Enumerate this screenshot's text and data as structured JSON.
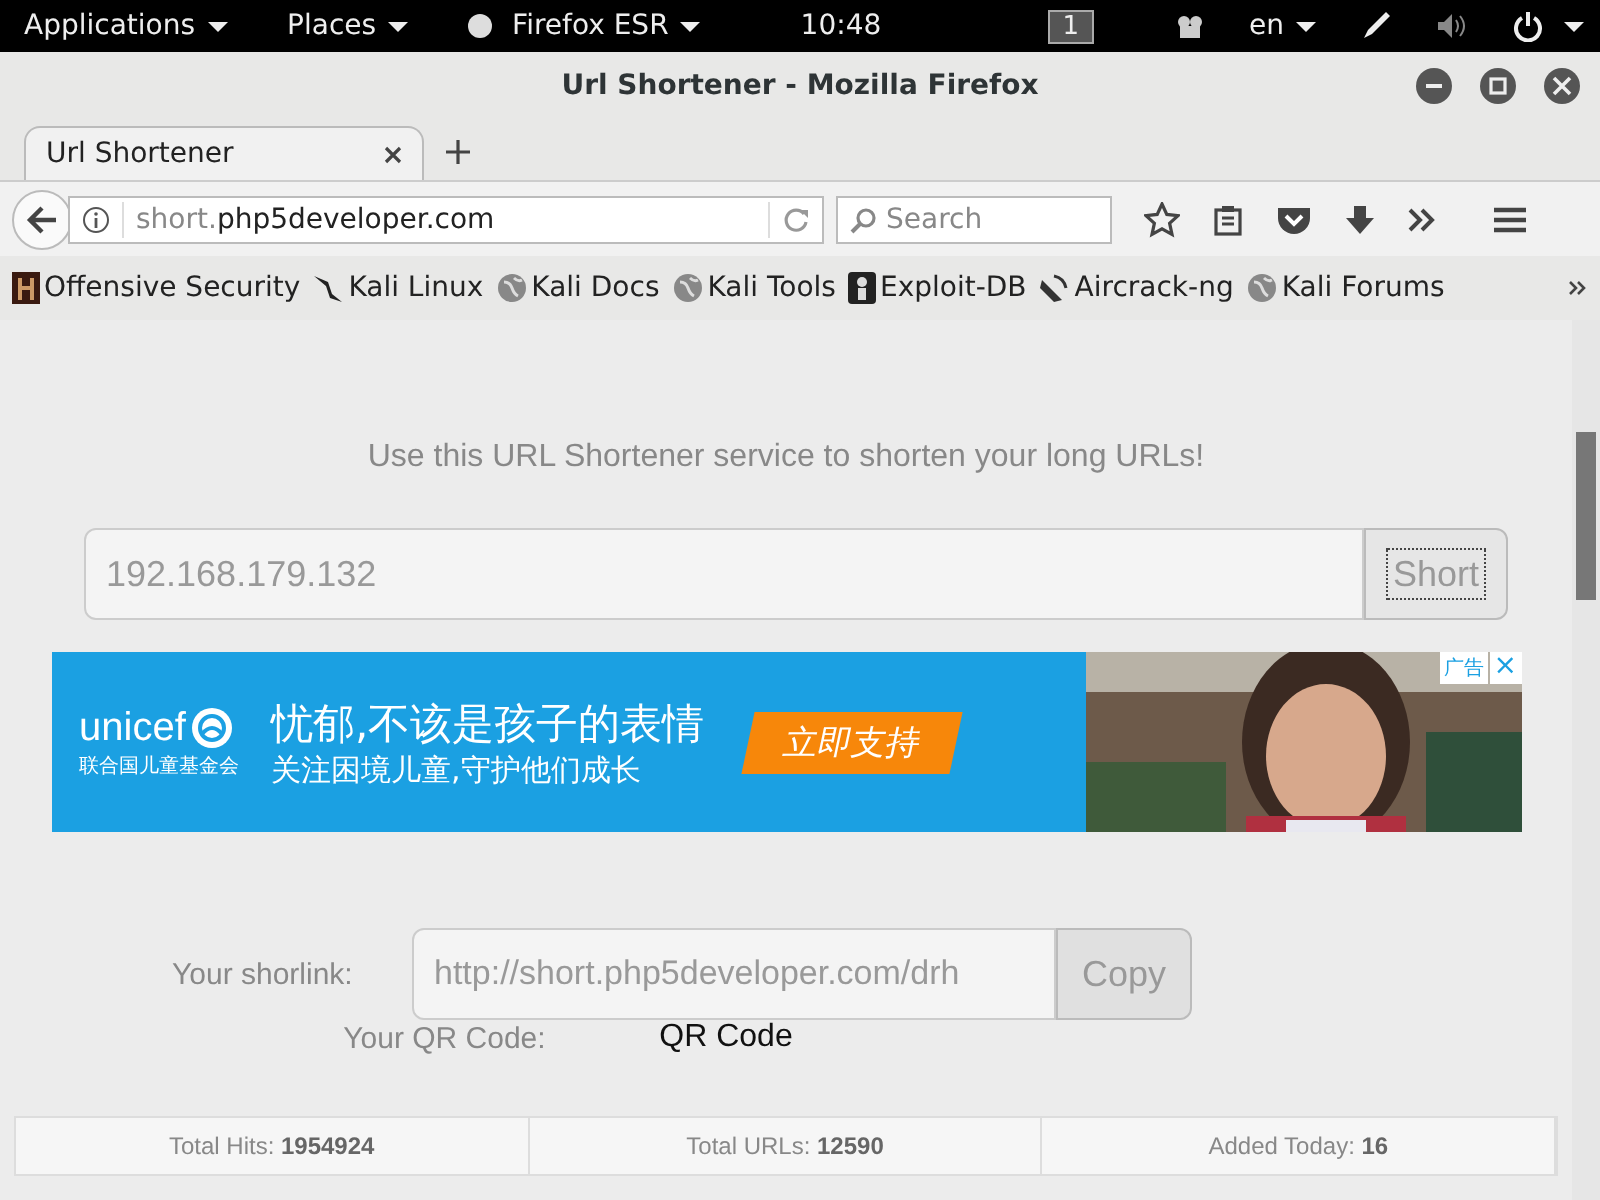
{
  "top_bar": {
    "menus": [
      {
        "label": "Applications"
      },
      {
        "label": "Places"
      },
      {
        "label": "Firefox ESR"
      }
    ],
    "clock": "10:48",
    "workspace": "1",
    "language": "en"
  },
  "window": {
    "title": "Url Shortener - Mozilla Firefox"
  },
  "tabs": [
    {
      "label": "Url Shortener",
      "selected": true
    }
  ],
  "url_bar": {
    "host_prefix": "short.",
    "domain": "php5developer.com"
  },
  "search": {
    "placeholder": "Search"
  },
  "bookmarks": [
    {
      "label": "Offensive Security"
    },
    {
      "label": "Kali Linux"
    },
    {
      "label": "Kali Docs"
    },
    {
      "label": "Kali Tools"
    },
    {
      "label": "Exploit-DB"
    },
    {
      "label": "Aircrack-ng"
    },
    {
      "label": "Kali Forums"
    }
  ],
  "page": {
    "intro": "Use this URL Shortener service to shorten your long URLs!",
    "url_input": {
      "placeholder": "192.168.179.132"
    },
    "short_button": "Short",
    "ad": {
      "brand": "unicef",
      "brand_sub": "联合国儿童基金会",
      "headline": "忧郁,不该是孩子的表情",
      "subline": "关注困境儿童,守护他们成长",
      "cta": "立即支持",
      "ad_tag": "广告",
      "close": "×"
    },
    "shortlink_label": "Your shorlink:",
    "shortlink_value": "http://short.php5developer.com/drh",
    "copy_button": "Copy",
    "qr_label": "Your QR Code:",
    "qr_value": "QR Code",
    "stats": [
      {
        "label": "Total Hits:",
        "value": "1954924"
      },
      {
        "label": "Total URLs:",
        "value": "12590"
      },
      {
        "label": "Added Today:",
        "value": "16"
      }
    ]
  }
}
